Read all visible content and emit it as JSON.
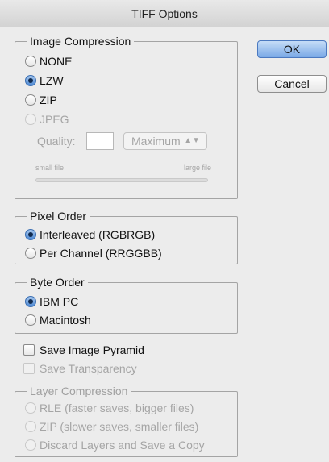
{
  "window": {
    "title": "TIFF Options"
  },
  "buttons": {
    "ok": "OK",
    "cancel": "Cancel"
  },
  "image_compression": {
    "legend": "Image Compression",
    "options": [
      "NONE",
      "LZW",
      "ZIP",
      "JPEG"
    ],
    "selected": "LZW",
    "quality_label": "Quality:",
    "quality_value": "",
    "quality_select": "Maximum",
    "small_file": "small file",
    "large_file": "large file"
  },
  "pixel_order": {
    "legend": "Pixel Order",
    "options": [
      "Interleaved (RGBRGB)",
      "Per Channel (RRGGBB)"
    ],
    "selected": "Interleaved (RGBRGB)"
  },
  "byte_order": {
    "legend": "Byte Order",
    "options": [
      "IBM PC",
      "Macintosh"
    ],
    "selected": "IBM PC"
  },
  "checkboxes": {
    "save_image_pyramid": "Save Image Pyramid",
    "save_transparency": "Save Transparency"
  },
  "layer_compression": {
    "legend": "Layer Compression",
    "options": [
      "RLE (faster saves, bigger files)",
      "ZIP (slower saves, smaller files)",
      "Discard Layers and Save a Copy"
    ]
  }
}
